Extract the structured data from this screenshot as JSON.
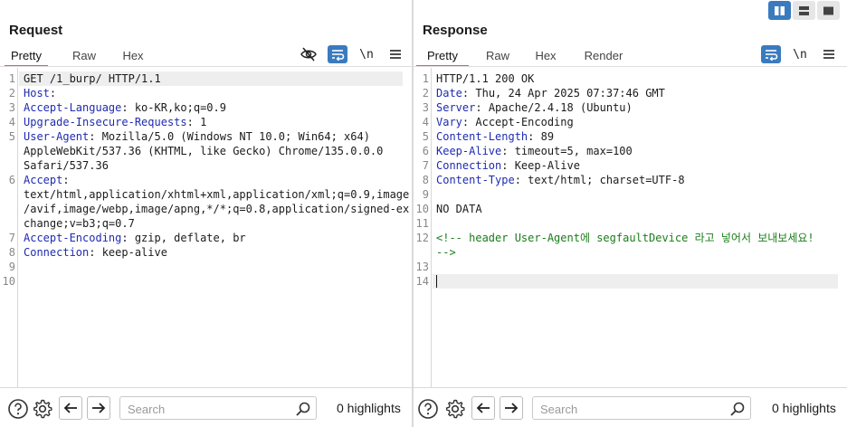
{
  "request": {
    "title": "Request",
    "tabs": [
      {
        "label": "Pretty",
        "active": true
      },
      {
        "label": "Raw",
        "active": false
      },
      {
        "label": "Hex",
        "active": false
      }
    ],
    "tools": {
      "newline": "\\n"
    },
    "line_numbers": [
      "1",
      "2",
      "3",
      "4",
      "5",
      "6",
      "7",
      "8",
      "9",
      "10"
    ],
    "lines": {
      "l1": "GET /1_burp/ HTTP/1.1",
      "l2_key": "Host",
      "l3_key": "Accept-Language",
      "l3_val": " ko-KR,ko;q=0.9",
      "l4_key": "Upgrade-Insecure-Requests",
      "l4_val": " 1",
      "l5_key": "User-Agent",
      "l5_val": " Mozilla/5.0 (Windows NT 10.0; Win64; x64)",
      "l5_w2": "AppleWebKit/537.36 (KHTML, like Gecko) Chrome/135.0.0.0",
      "l5_w3": "Safari/537.36",
      "l6_key": "Accept",
      "l6_w2": "text/html,application/xhtml+xml,application/xml;q=0.9,image",
      "l6_w3": "/avif,image/webp,image/apng,*/*;q=0.8,application/signed-ex",
      "l6_w4": "change;v=b3;q=0.7",
      "l7_key": "Accept-Encoding",
      "l7_val": " gzip, deflate, br",
      "l8_key": "Connection",
      "l8_val": " keep-alive"
    },
    "search_placeholder": "Search",
    "highlights": "0 highlights"
  },
  "response": {
    "title": "Response",
    "tabs": [
      {
        "label": "Pretty",
        "active": true
      },
      {
        "label": "Raw",
        "active": false
      },
      {
        "label": "Hex",
        "active": false
      },
      {
        "label": "Render",
        "active": false
      }
    ],
    "tools": {
      "newline": "\\n"
    },
    "line_numbers": [
      "1",
      "2",
      "3",
      "4",
      "5",
      "6",
      "7",
      "8",
      "9",
      "10",
      "11",
      "12",
      "13",
      "14"
    ],
    "lines": {
      "l1": "HTTP/1.1 200 OK",
      "l2_key": "Date",
      "l2_val": " Thu, 24 Apr 2025 07:37:46 GMT",
      "l3_key": "Server",
      "l3_val": " Apache/2.4.18 (Ubuntu)",
      "l4_key": "Vary",
      "l4_val": " Accept-Encoding",
      "l5_key": "Content-Length",
      "l5_val": " 89",
      "l6_key": "Keep-Alive",
      "l6_val": " timeout=5, max=100",
      "l7_key": "Connection",
      "l7_val": " Keep-Alive",
      "l8_key": "Content-Type",
      "l8_val": " text/html; charset=UTF-8",
      "l10": "NO DATA",
      "l12": "<!-- header User-Agent에 segfaultDevice 라고 넣어서 보내보세요!",
      "l12_w2": "-->"
    },
    "search_placeholder": "Search",
    "highlights": "0 highlights"
  },
  "layout_buttons": [
    {
      "name": "side-by-side",
      "active": true
    },
    {
      "name": "stacked",
      "active": false
    },
    {
      "name": "single",
      "active": false
    }
  ],
  "colors": {
    "accent": "#e8603c",
    "toggle_blue": "#3a7bbf",
    "header_key": "#1f2bb0",
    "comment": "#1a7d1a"
  }
}
